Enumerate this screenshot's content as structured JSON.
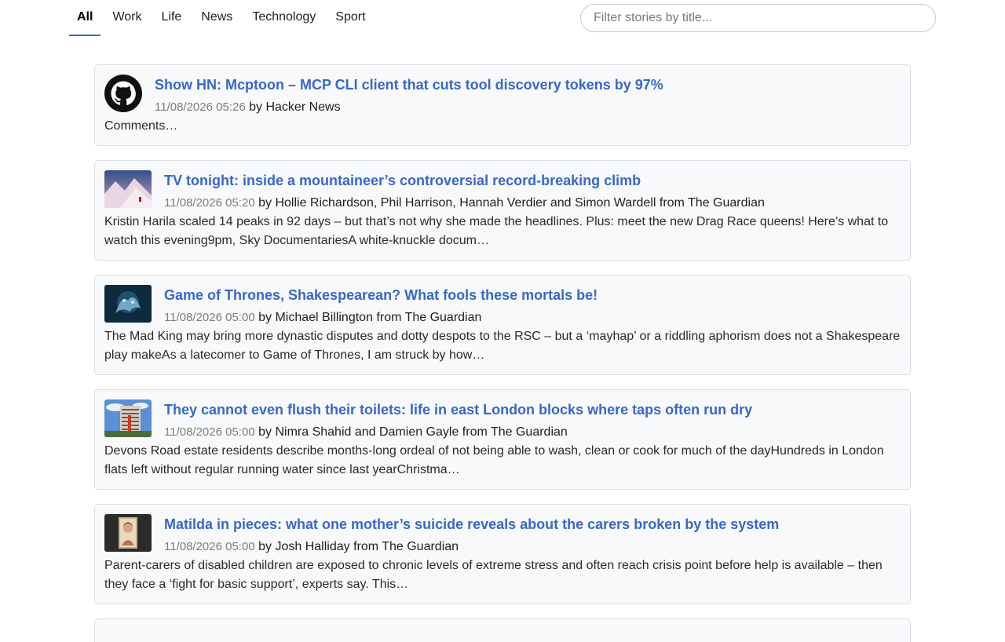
{
  "tabs": [
    {
      "label": "All",
      "active": true
    },
    {
      "label": "Work"
    },
    {
      "label": "Life"
    },
    {
      "label": "News"
    },
    {
      "label": "Technology"
    },
    {
      "label": "Sport"
    }
  ],
  "search": {
    "placeholder": "Filter stories by title..."
  },
  "stories": [
    {
      "title": "Show HN: Mcptoon – MCP CLI client that cuts tool discovery tokens by 97%",
      "date": "11/08/2026 05:26",
      "byline": " by Hacker News",
      "summary": "Comments…",
      "thumb_icon": "github-logo-icon"
    },
    {
      "title": "TV tonight: inside a mountaineer’s controversial record-breaking climb",
      "date": "11/08/2026 05:20",
      "byline": " by Hollie Richardson, Phil Harrison, Hannah Verdier and Simon Wardell from The Guardian",
      "summary": "Kristin Harila scaled 14 peaks in 92 days – but that’s not why she made the headlines. Plus: meet the new Drag Race queens! Here’s what to watch this evening9pm, Sky DocumentariesA white-knuckle docum…",
      "thumb_icon": "mountain-photo"
    },
    {
      "title": "Game of Thrones, Shakespearean? What fools these mortals be!",
      "date": "11/08/2026 05:00",
      "byline": " by Michael Billington from The Guardian",
      "summary": "The Mad King may bring more dynastic disputes and dotty despots to the RSC – but a ‘mayhap’ or a riddling aphorism does not a Shakespeare play makeAs a latecomer to Game of Thrones, I am struck by how…",
      "thumb_icon": "dragon-photo"
    },
    {
      "title": "They cannot even flush their toilets: life in east London blocks where taps often run dry",
      "date": "11/08/2026 05:00",
      "byline": " by Nimra Shahid and Damien Gayle from The Guardian",
      "summary": "Devons Road estate residents describe months-long ordeal of not being able to wash, clean or cook for much of the dayHundreds in London flats left without regular running water since last yearChristma…",
      "thumb_icon": "tower-block-photo"
    },
    {
      "title": "Matilda in pieces: what one mother’s suicide reveals about the carers broken by the system",
      "date": "11/08/2026 05:00",
      "byline": " by Josh Halliday from The Guardian",
      "summary": "Parent-carers of disabled children are exposed to chronic levels of extreme stress and often reach crisis point before help is available – then they face a ‘fight for basic support’, experts say. This…",
      "thumb_icon": "portrait-photo"
    }
  ]
}
